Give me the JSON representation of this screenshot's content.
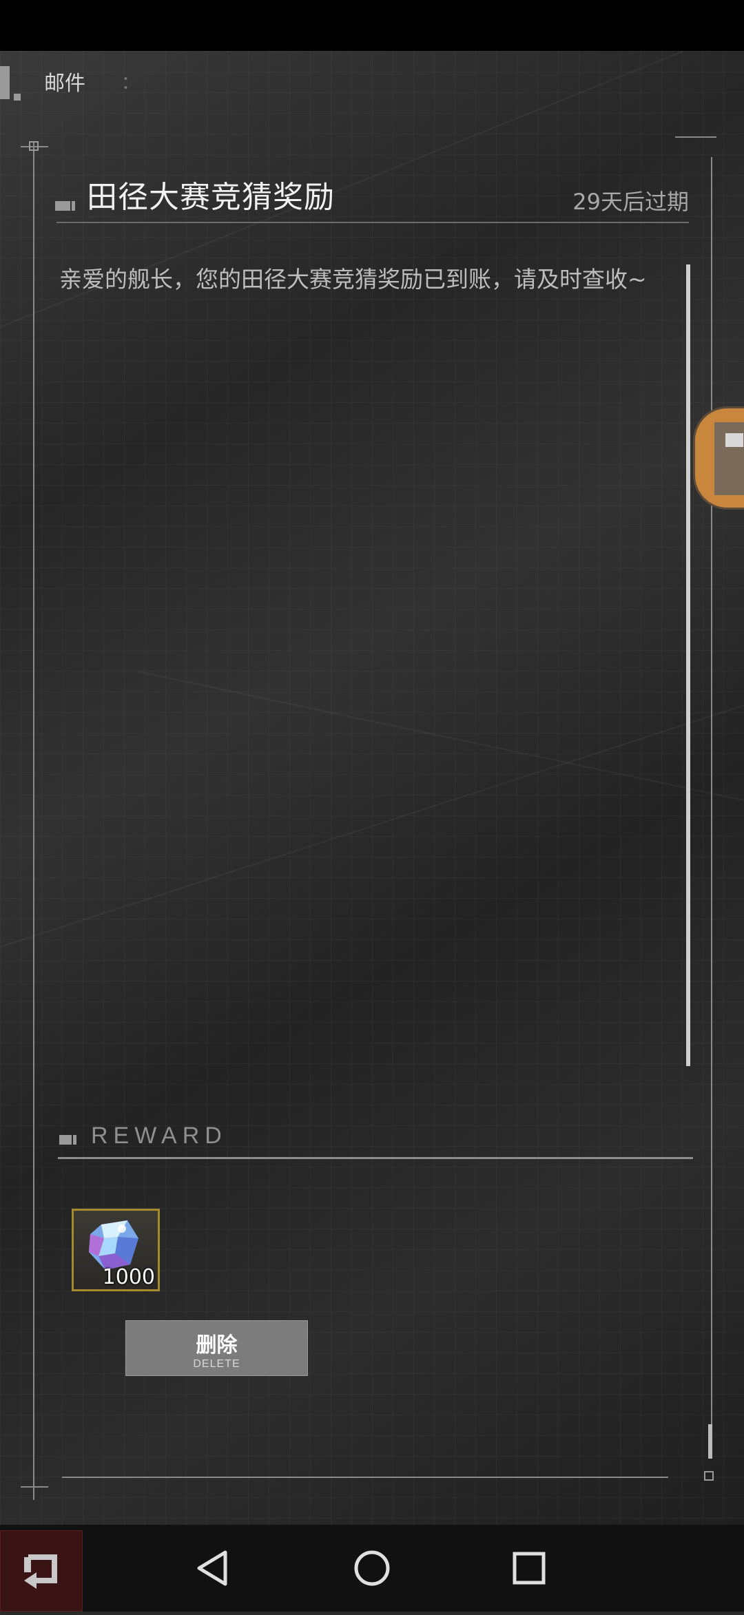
{
  "header": {
    "title": "邮件",
    "separator": "："
  },
  "mail": {
    "title": "田径大赛竞猜奖励",
    "expire": "29天后过期",
    "body": "亲爱的舰长，您的田径大赛竞猜奖励已到账，请及时查收~"
  },
  "reward": {
    "label": "REWARD",
    "items": [
      {
        "name": "crystal-icon",
        "count": "1000"
      }
    ]
  },
  "actions": {
    "delete_label": "删除",
    "delete_sub": "DELETE"
  },
  "nav": {
    "back": "back-icon",
    "nav_back": "triangle-back-icon",
    "home": "circle-home-icon",
    "recents": "square-recents-icon"
  },
  "colors": {
    "item_border": "#a88a2e",
    "back_button": "#3a1414",
    "delete_button": "#7c7c7c"
  }
}
